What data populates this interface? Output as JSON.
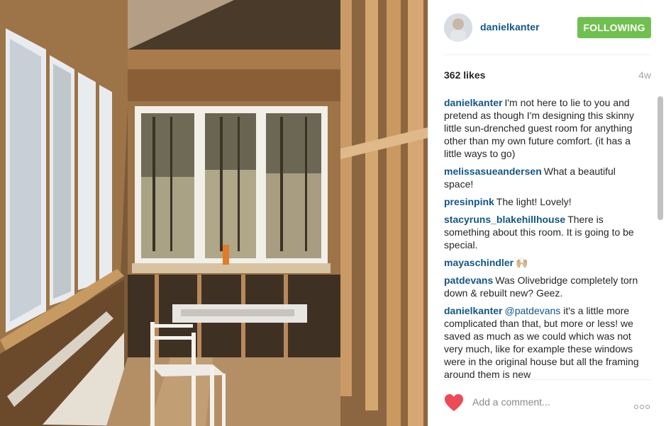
{
  "post": {
    "username": "danielkanter",
    "follow_label": "FOLLOWING",
    "likes": "362 likes",
    "age": "4w"
  },
  "comments": [
    {
      "user": "danielkanter",
      "text": "I'm not here to lie to you and pretend as though I'm designing this skinny little sun-drenched guest room for anything other than my own future comfort. (it has a little ways to go)"
    },
    {
      "user": "melissasueandersen",
      "text": "What a beautiful space!"
    },
    {
      "user": "presinpink",
      "text": "The light! Lovely!"
    },
    {
      "user": "stacyruns_blakehillhouse",
      "text": "There is something about this room. It is going to be special."
    },
    {
      "user": "mayaschindler",
      "text": "🙌🏼"
    },
    {
      "user": "patdevans",
      "text": "Was Olivebridge completely torn down & rebuilt new? Geez."
    },
    {
      "user": "danielkanter",
      "mention": "@patdevans",
      "text": "it's a little more complicated than that, but more or less! we saved as much as we could which was not very much, like for example these windows were in the original house but all the framing around them is new"
    }
  ],
  "footer": {
    "comment_placeholder": "Add a comment..."
  },
  "icons": {
    "heart": "heart-icon",
    "more": "more-options-icon"
  },
  "colors": {
    "follow_bg": "#70c050",
    "username": "#125688",
    "heart": "#ed4956"
  }
}
